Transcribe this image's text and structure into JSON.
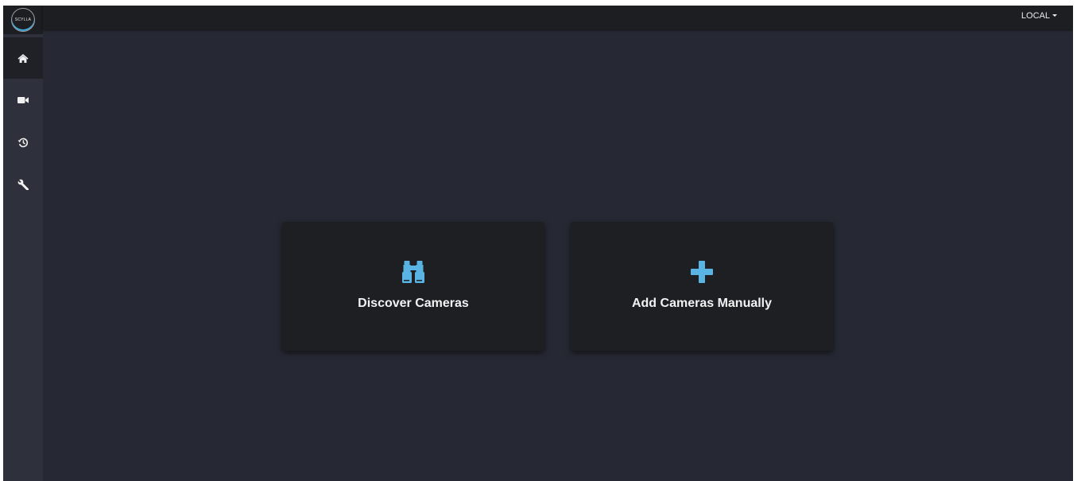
{
  "brand": {
    "logo_text": "SCYLLA"
  },
  "header": {
    "environment_label": "LOCAL"
  },
  "sidebar": {
    "items": [
      {
        "icon": "home-icon",
        "active": true
      },
      {
        "icon": "video-camera-icon",
        "active": false
      },
      {
        "icon": "history-icon",
        "active": false
      },
      {
        "icon": "wrench-icon",
        "active": false
      }
    ]
  },
  "main": {
    "actions": [
      {
        "label": "Discover Cameras",
        "icon": "binoculars-icon"
      },
      {
        "label": "Add Cameras Manually",
        "icon": "plus-icon"
      }
    ]
  },
  "colors": {
    "accent": "#5ab4e3",
    "background": "#262933",
    "card": "#1e1f23",
    "topbar": "#1d1e22",
    "sidebar": "#2e313b"
  }
}
